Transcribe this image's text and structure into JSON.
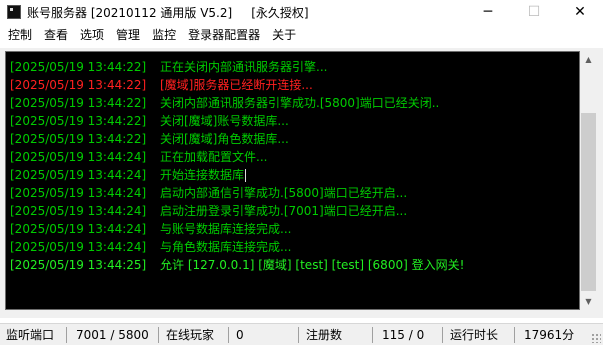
{
  "window": {
    "title": "账号服务器 [20210112 通用版 V5.2]     [永久授权]",
    "controls": {
      "minimize": "─",
      "maximize": "☐",
      "close": "✕"
    }
  },
  "menu": {
    "items": [
      "控制",
      "查看",
      "选项",
      "管理",
      "监控",
      "登录器配置器",
      "关于"
    ]
  },
  "log": {
    "lines": [
      {
        "time": "[2025/05/19 13:44:22]",
        "message": "正在关闭内部通讯服务器引擎...",
        "color": "#00cc00"
      },
      {
        "time": "[2025/05/19 13:44:22]",
        "message": "[魔域]服务器已经断开连接...",
        "color": "#ff2020"
      },
      {
        "time": "[2025/05/19 13:44:22]",
        "message": "关闭内部通讯服务器引擎成功.[5800]端口已经关闭..",
        "color": "#00cc00"
      },
      {
        "time": "[2025/05/19 13:44:22]",
        "message": "关闭[魔域]账号数据库...",
        "color": "#00cc00"
      },
      {
        "time": "[2025/05/19 13:44:22]",
        "message": "关闭[魔域]角色数据库...",
        "color": "#00cc00"
      },
      {
        "time": "[2025/05/19 13:44:24]",
        "message": "正在加载配置文件...",
        "color": "#00cc00"
      },
      {
        "time": "[2025/05/19 13:44:24]",
        "message": "开始连接数据库",
        "color": "#00cc00"
      },
      {
        "time": "[2025/05/19 13:44:24]",
        "message": "启动内部通信引擎成功.[5800]端口已经开启...",
        "color": "#00cc00"
      },
      {
        "time": "[2025/05/19 13:44:24]",
        "message": "启动注册登录引擎成功.[7001]端口已经开启...",
        "color": "#00cc00"
      },
      {
        "time": "[2025/05/19 13:44:24]",
        "message": "与账号数据库连接完成...",
        "color": "#00cc00"
      },
      {
        "time": "[2025/05/19 13:44:24]",
        "message": "与角色数据库连接完成...",
        "color": "#00cc00"
      },
      {
        "time": "[2025/05/19 13:44:25]",
        "message": "允许 [127.0.0.1] [魔域] [test] [test] [6800] 登入网关!",
        "color": "#22ee22"
      }
    ]
  },
  "scrollbar": {
    "up_icon": "scroll-up-arrow-icon",
    "down_icon": "scroll-down-arrow-icon",
    "up_glyph": "▲",
    "down_glyph": "▼"
  },
  "statusbar": {
    "port_label": "监听端口",
    "port_value": "7001 / 5800",
    "online_label": "在线玩家",
    "online_value": "0",
    "reg_label": "注册数",
    "reg_value": "115 / 0",
    "uptime_label": "运行时长",
    "uptime_value": "17961分"
  }
}
